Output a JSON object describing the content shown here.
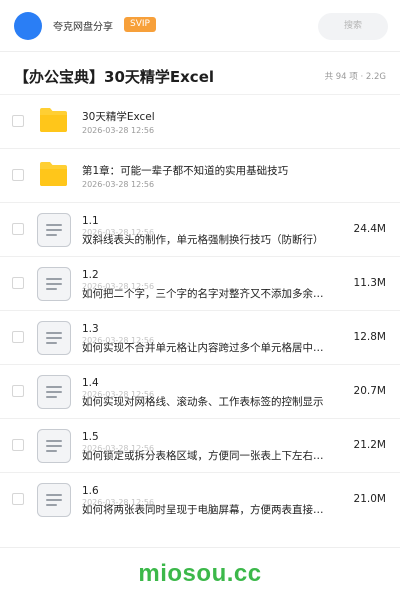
{
  "header": {
    "username": "夸克网盘分享",
    "badge": "SVIP",
    "search_placeholder": "搜索",
    "colors": {
      "avatar": "#2a7ef5",
      "badge": "#f7a03a"
    }
  },
  "folder_title": "【办公宝典】30天精学Excel",
  "folder_meta": "共 94 项 · 2.2G",
  "folders": [
    {
      "name": "30天精学Excel",
      "date": "2026-03-28 12:56",
      "icon": "folder-icon"
    },
    {
      "name": "第1章：可能一辈子都不知道的实用基础技巧",
      "date": "2026-03-28 12:56",
      "icon": "folder-icon"
    }
  ],
  "files": [
    {
      "index": "1.1",
      "date": "2026-03-28 12:56",
      "desc": "双斜线表头的制作，单元格强制换行技巧（防断行）",
      "size": "24.4M",
      "icon": "document-icon"
    },
    {
      "index": "1.2",
      "date": "2026-03-28 12:56",
      "desc": "如何把二个字，三个字的名字对整齐又不添加多余空格",
      "size": "11.3M",
      "icon": "document-icon"
    },
    {
      "index": "1.3",
      "date": "2026-03-28 12:56",
      "desc": "如何实现不合并单元格让内容跨过多个单元格居中显示",
      "size": "12.8M",
      "icon": "document-icon"
    },
    {
      "index": "1.4",
      "date": "2026-03-28 12:56",
      "desc": "如何实现对网格线、滚动条、工作表标签的控制显示",
      "size": "20.7M",
      "icon": "document-icon"
    },
    {
      "index": "1.5",
      "date": "2026-03-28 12:56",
      "desc": "如何锁定或拆分表格区域，方便同一张表上下左右查看",
      "size": "21.2M",
      "icon": "document-icon"
    },
    {
      "index": "1.6",
      "date": "2026-03-28 12:56",
      "desc": "如何将两张表同时呈现于电脑屏幕，方便两表直接对比",
      "size": "21.0M",
      "icon": "document-icon"
    }
  ],
  "watermark": "miosou.cc",
  "colors": {
    "watermark": "#3cb84a",
    "folder": "#ffcf33"
  }
}
